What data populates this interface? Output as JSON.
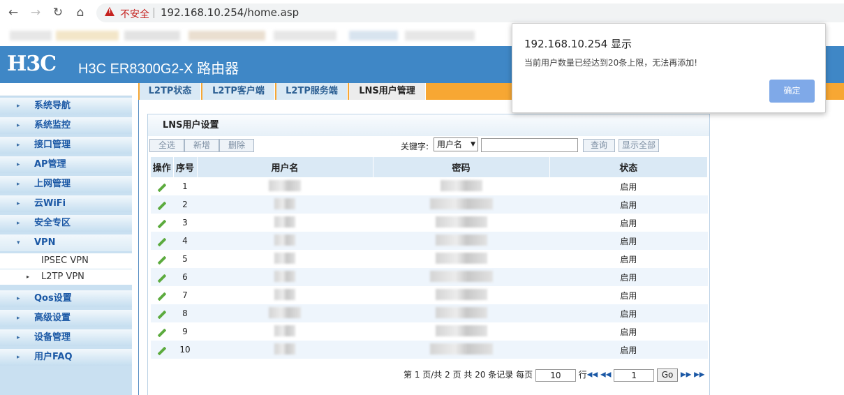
{
  "browser": {
    "security_label": "不安全",
    "url": "192.168.10.254/home.asp"
  },
  "header": {
    "logo": "H3C",
    "title": "H3C ER8300G2-X 路由器"
  },
  "tabs": [
    {
      "label": "L2TP状态"
    },
    {
      "label": "L2TP客户端"
    },
    {
      "label": "L2TP服务端"
    },
    {
      "label": "LNS用户管理",
      "active": true
    }
  ],
  "sidebar": {
    "items": [
      {
        "label": "系统导航"
      },
      {
        "label": "系统监控"
      },
      {
        "label": "接口管理"
      },
      {
        "label": "AP管理"
      },
      {
        "label": "上网管理"
      },
      {
        "label": "云WiFi"
      },
      {
        "label": "安全专区"
      },
      {
        "label": "VPN",
        "expanded": true
      },
      {
        "label": "Qos设置"
      },
      {
        "label": "高级设置"
      },
      {
        "label": "设备管理"
      },
      {
        "label": "用户FAQ"
      }
    ],
    "vpn_sub": [
      {
        "label": "IPSEC VPN"
      },
      {
        "label": "L2TP VPN",
        "selected": true
      }
    ]
  },
  "panel": {
    "title": "LNS用户设置",
    "toolbar": {
      "select_all": "全选",
      "add": "新增",
      "delete": "删除",
      "keyword_label": "关键字:",
      "keyword_option": "用户名",
      "keyword_value": "",
      "query": "查询",
      "show_all": "显示全部"
    },
    "columns": [
      "操作",
      "序号",
      "用户名",
      "密码",
      "状态"
    ],
    "rows": [
      {
        "no": "1",
        "status": "启用"
      },
      {
        "no": "2",
        "status": "启用"
      },
      {
        "no": "3",
        "status": "启用"
      },
      {
        "no": "4",
        "status": "启用"
      },
      {
        "no": "5",
        "status": "启用"
      },
      {
        "no": "6",
        "status": "启用"
      },
      {
        "no": "7",
        "status": "启用"
      },
      {
        "no": "8",
        "status": "启用"
      },
      {
        "no": "9",
        "status": "启用"
      },
      {
        "no": "10",
        "status": "启用"
      }
    ],
    "pager": {
      "summary": "第 1 页/共 2 页 共 20 条记录 每页",
      "per_page": "10",
      "row_label": "行",
      "page": "1",
      "go": "Go"
    }
  },
  "dialog": {
    "title": "192.168.10.254 显示",
    "message": "当前用户数量已经达到20条上限，无法再添加!",
    "ok": "确定"
  },
  "colors": {
    "header_blue": "#3f87c6",
    "tab_orange": "#f7a733",
    "alert_red": "#c5221f",
    "ok_button": "#7fa9e8"
  }
}
